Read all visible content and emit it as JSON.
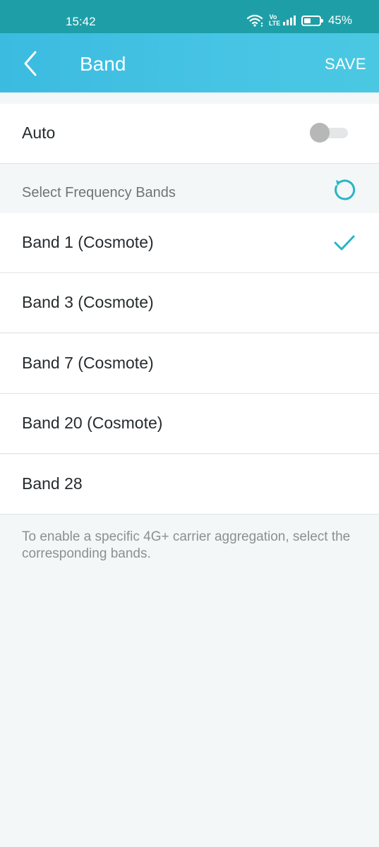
{
  "status_bar": {
    "time": "15:42",
    "network_badge": "Vo LTE",
    "battery_percent": "45%",
    "battery_level": 0.45
  },
  "header": {
    "title": "Band",
    "save_label": "SAVE",
    "back_icon": "chevron-left-icon",
    "gradient": [
      "#3bbbe0",
      "#4ac8e2"
    ]
  },
  "auto": {
    "label": "Auto",
    "enabled": false
  },
  "section": {
    "title": "Select Frequency Bands",
    "reset_icon": "reset-icon"
  },
  "bands": [
    {
      "label": "Band 1 (Cosmote)",
      "selected": true
    },
    {
      "label": "Band 3 (Cosmote)",
      "selected": false
    },
    {
      "label": "Band 7 (Cosmote)",
      "selected": false
    },
    {
      "label": "Band 20 (Cosmote)",
      "selected": false
    },
    {
      "label": "Band 28",
      "selected": false
    }
  ],
  "footer_note": "To enable a specific 4G+ carrier aggregation, select the corresponding bands.",
  "colors": {
    "accent": "#27b6c4",
    "status_bar": "#1e9fa8",
    "background": "#f3f7f8"
  }
}
